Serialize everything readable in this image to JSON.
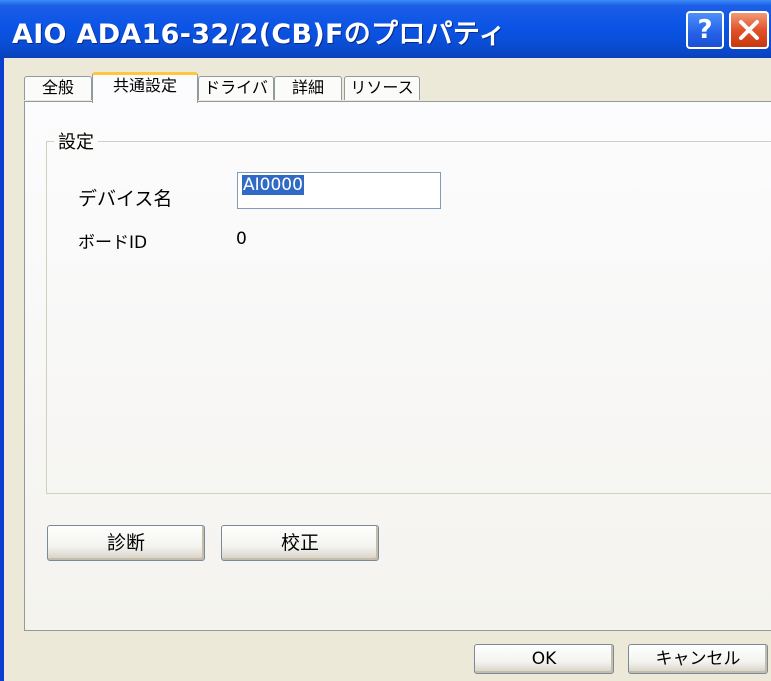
{
  "window": {
    "title": "AIO ADA16-32/2(CB)Fのプロパティ",
    "help_label": "?"
  },
  "tabs": [
    {
      "label": "全般"
    },
    {
      "label": "共通設定"
    },
    {
      "label": "ドライバ"
    },
    {
      "label": "詳細"
    },
    {
      "label": "リソース"
    }
  ],
  "settings": {
    "group_label": "設定",
    "device_name_label": "デバイス名",
    "device_name_value": "AI0000",
    "board_id_label": "ボードID",
    "board_id_value": "0"
  },
  "actions": {
    "diagnose_label": "診断",
    "calibrate_label": "校正"
  },
  "footer": {
    "ok_label": "OK",
    "cancel_label": "キャンセル"
  },
  "colors": {
    "titlebar": "#0a54e6",
    "close_button": "#e2522a",
    "selection": "#316ac5",
    "active_tab_accent": "#ffc83c"
  }
}
